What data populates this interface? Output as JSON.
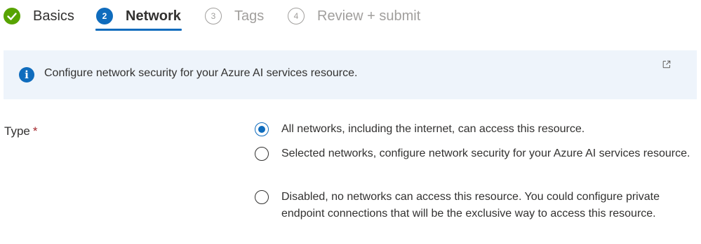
{
  "wizard": {
    "tabs": [
      {
        "label": "Basics",
        "state": "completed",
        "badge": ""
      },
      {
        "label": "Network",
        "state": "active",
        "badge": "2"
      },
      {
        "label": "Tags",
        "state": "upcoming",
        "badge": "3"
      },
      {
        "label": "Review + submit",
        "state": "upcoming",
        "badge": "4"
      }
    ]
  },
  "info_banner": {
    "icon": "info-icon",
    "text": "Configure network security for your Azure AI services resource.",
    "link_icon": "external-link-icon"
  },
  "type_field": {
    "label": "Type",
    "required_marker": "*",
    "selected_index": 0,
    "options": [
      {
        "label": "All networks, including the internet, can access this resource."
      },
      {
        "label": "Selected networks, configure network security for your Azure AI services resource."
      },
      {
        "label": "Disabled, no networks can access this resource. You could configure private endpoint connections that will be the exclusive way to access this resource."
      }
    ]
  },
  "colors": {
    "accent": "#0f6cbd",
    "success": "#57a300",
    "banner_bg": "#eef4fb",
    "required": "#a4262c",
    "muted": "#a19f9d"
  }
}
